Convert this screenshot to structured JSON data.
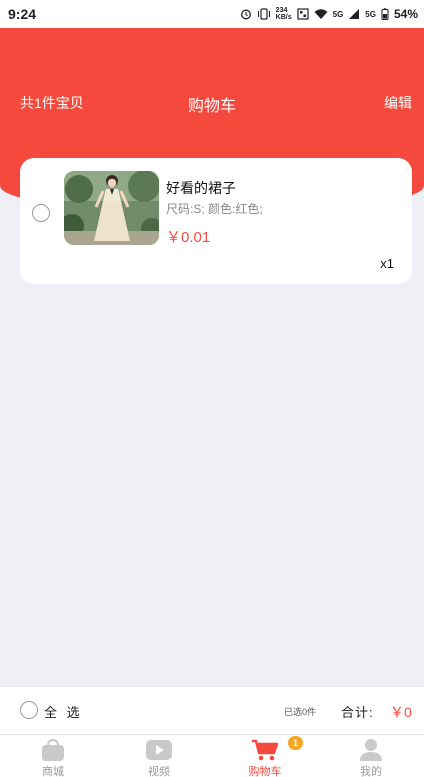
{
  "status_bar": {
    "time": "9:24",
    "network_speed": "234\nKB/s",
    "signal_5g_1": "5G",
    "signal_5g_2": "5G",
    "battery": "54%"
  },
  "header": {
    "item_count": "共1件宝贝",
    "title": "购物车",
    "edit": "编辑"
  },
  "cart_item": {
    "name": "好看的裙子",
    "spec": "尺码:S; 颜色:红色;",
    "price": "￥0.01",
    "quantity": "x1"
  },
  "footer": {
    "select_all": "全 选",
    "selected_count": "已选0件",
    "total_label": "合计:",
    "total_value": "￥0"
  },
  "tabbar": {
    "tabs": [
      {
        "label": "商城",
        "icon": "bag-icon"
      },
      {
        "label": "视频",
        "icon": "play-icon"
      },
      {
        "label": "购物车",
        "icon": "cart-icon",
        "badge": "1"
      },
      {
        "label": "我的",
        "icon": "user-icon"
      }
    ]
  },
  "colors": {
    "accent": "#f6493e",
    "badge": "#f5a623",
    "background": "#eef0f5",
    "inactive_tab": "#c9c9c9"
  }
}
